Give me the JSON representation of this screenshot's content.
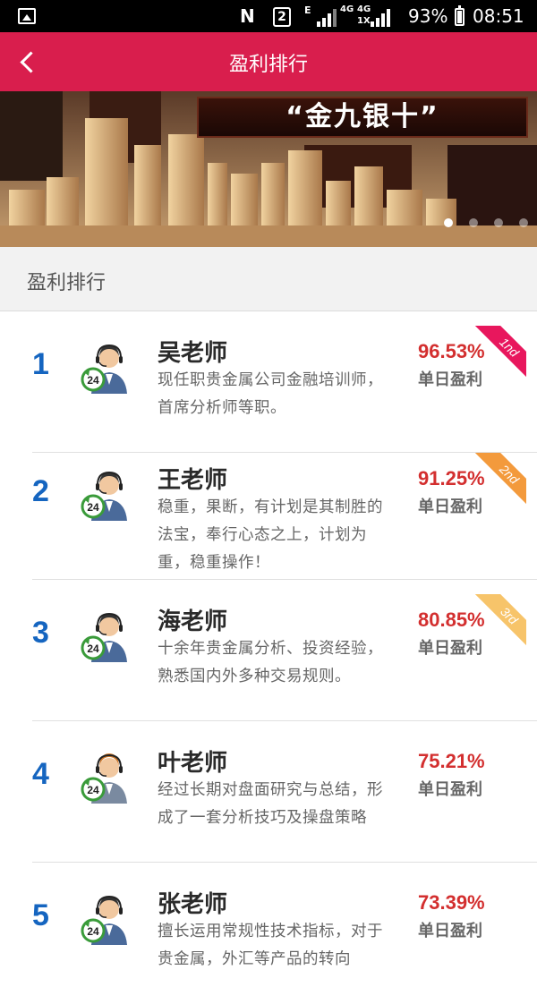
{
  "status_bar": {
    "network_letter": "N",
    "sim_slot": "2",
    "network_e": "E",
    "network_4g_a": "4G",
    "network_4g_b": "4G",
    "network_1x": "1X",
    "battery_percent": "93%",
    "time": "08:51"
  },
  "header": {
    "title": "盈利排行"
  },
  "banner": {
    "text": "“金九银十”",
    "slide_count": 4,
    "active_slide": 1
  },
  "section": {
    "title": "盈利排行"
  },
  "rankings": [
    {
      "rank": "1",
      "name": "吴老师",
      "desc": "现任职贵金属公司金融培训师，首席分析师等职。",
      "percent": "96.53%",
      "percent_label": "单日盈利",
      "badge": "1nd",
      "badge_color": "#e8175d"
    },
    {
      "rank": "2",
      "name": "王老师",
      "desc": "稳重，果断，有计划是其制胜的法宝，奉行心态之上，计划为重，稳重操作！",
      "percent": "91.25%",
      "percent_label": "单日盈利",
      "badge": "2nd",
      "badge_color": "#f39a3c"
    },
    {
      "rank": "3",
      "name": "海老师",
      "desc": "十余年贵金属分析、投资经验，熟悉国内外多种交易规则。",
      "percent": "80.85%",
      "percent_label": "单日盈利",
      "badge": "3rd",
      "badge_color": "#f7c46a"
    },
    {
      "rank": "4",
      "name": "叶老师",
      "desc": "经过长期对盘面研究与总结，形成了一套分析技巧及操盘策略",
      "percent": "75.21%",
      "percent_label": "单日盈利",
      "badge": "",
      "badge_color": ""
    },
    {
      "rank": "5",
      "name": "张老师",
      "desc": "擅长运用常规性技术指标，对于贵金属，外汇等产品的转向",
      "percent": "73.39%",
      "percent_label": "单日盈利",
      "badge": "",
      "badge_color": ""
    }
  ],
  "avatar_badge": "24",
  "colors": {
    "brand": "#d91e4d",
    "rank_blue": "#1565c0",
    "percent_red": "#d32f2f",
    "badge_green": "#3a9b3a"
  }
}
